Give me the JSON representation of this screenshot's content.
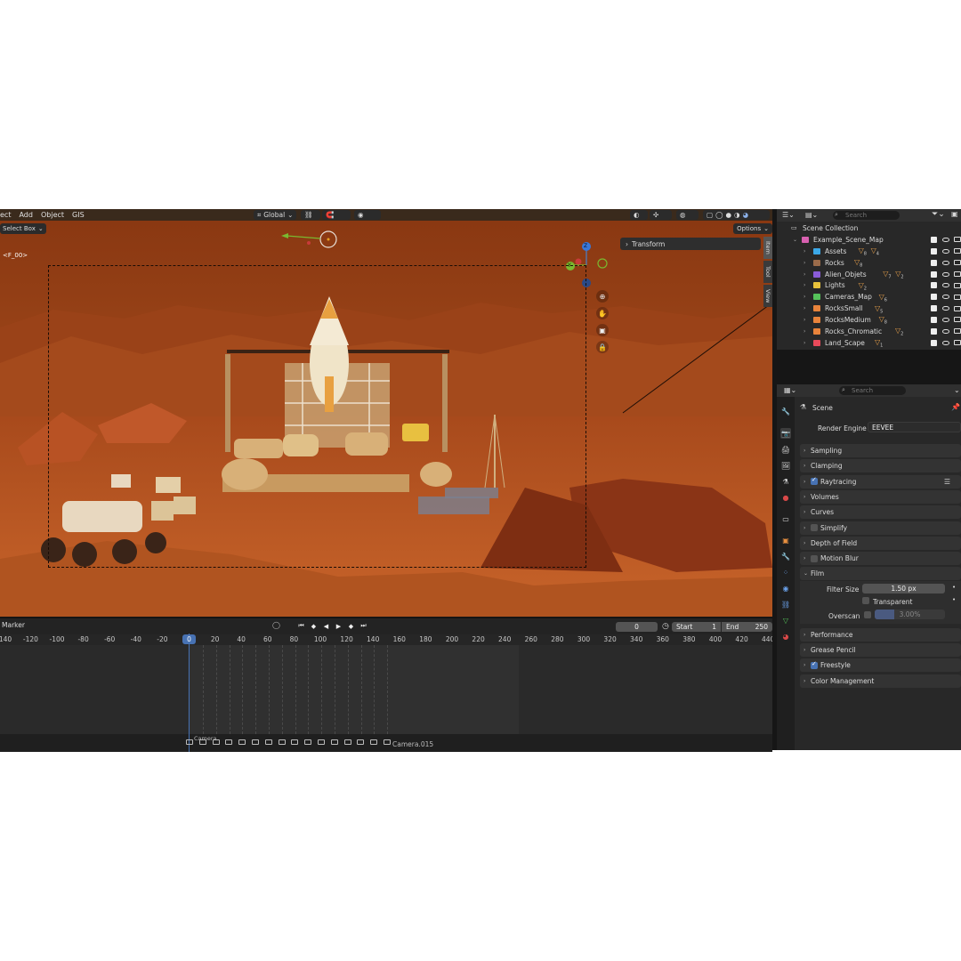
{
  "viewport": {
    "menu": [
      "ect",
      "Add",
      "Object",
      "GIS"
    ],
    "orientation": "Global",
    "select_mode": "Select Box",
    "options_label": "Options",
    "camera_name": "<F_00>",
    "npanel_tabs": [
      "Item",
      "Tool",
      "View"
    ],
    "transform_label": "Transform",
    "gizmo_axes": [
      "Y",
      "Z"
    ]
  },
  "timeline": {
    "marker_label": "Marker",
    "current_frame": "0",
    "start_label": "Start",
    "start_value": "1",
    "end_label": "End",
    "end_value": "250",
    "playhead_frame": "0",
    "ruler": [
      "140",
      "-120",
      "-100",
      "-80",
      "-60",
      "-40",
      "-20",
      "20",
      "40",
      "60",
      "80",
      "100",
      "120",
      "140",
      "160",
      "180",
      "200",
      "220",
      "240",
      "260",
      "280",
      "300",
      "320",
      "340",
      "360",
      "380",
      "400",
      "420",
      "440"
    ],
    "first_marker": "Camera",
    "last_marker": "Camera.015"
  },
  "outliner": {
    "search_placeholder": "Search",
    "root": "Scene Collection",
    "scene": "Example_Scene_Map",
    "collections": [
      {
        "name": "Assets",
        "color": "#3ba8e8",
        "sub": [
          "8",
          "4"
        ]
      },
      {
        "name": "Rocks",
        "color": "#9a6b4a",
        "sub": [
          "8"
        ]
      },
      {
        "name": "Alien_Objets",
        "color": "#8a5cd8",
        "sub": [
          "7",
          "2"
        ]
      },
      {
        "name": "Lights",
        "color": "#e8c23b",
        "sub": [
          "2"
        ]
      },
      {
        "name": "Cameras_Map",
        "color": "#55c25a",
        "sub": [
          "6"
        ]
      },
      {
        "name": "RocksSmall",
        "color": "#e8833b",
        "sub": [
          "5"
        ]
      },
      {
        "name": "RocksMedium",
        "color": "#e8833b",
        "sub": [
          "8"
        ]
      },
      {
        "name": "Rocks_Chromatic",
        "color": "#e8833b",
        "sub": [
          "2"
        ]
      },
      {
        "name": "Land_Scape",
        "color": "#e84a5a",
        "sub": [
          "1"
        ]
      }
    ]
  },
  "properties": {
    "search_placeholder": "Search",
    "scene_label": "Scene",
    "render_engine_label": "Render Engine",
    "render_engine_value": "EEVEE",
    "panels": [
      {
        "label": "Sampling"
      },
      {
        "label": "Clamping"
      },
      {
        "label": "Raytracing",
        "checked": true
      },
      {
        "label": "Volumes"
      },
      {
        "label": "Curves"
      },
      {
        "label": "Simplify",
        "checkbox": true
      },
      {
        "label": "Depth of Field"
      },
      {
        "label": "Motion Blur",
        "checkbox": true
      },
      {
        "label": "Film",
        "open": true
      }
    ],
    "film": {
      "filter_size_label": "Filter Size",
      "filter_size_value": "1.50 px",
      "transparent_label": "Transparent",
      "overscan_label": "Overscan",
      "overscan_value": "3.00%"
    },
    "panels_after": [
      {
        "label": "Performance"
      },
      {
        "label": "Grease Pencil"
      },
      {
        "label": "Freestyle",
        "checked": true
      },
      {
        "label": "Color Management"
      }
    ],
    "accent": "#4772b3"
  }
}
